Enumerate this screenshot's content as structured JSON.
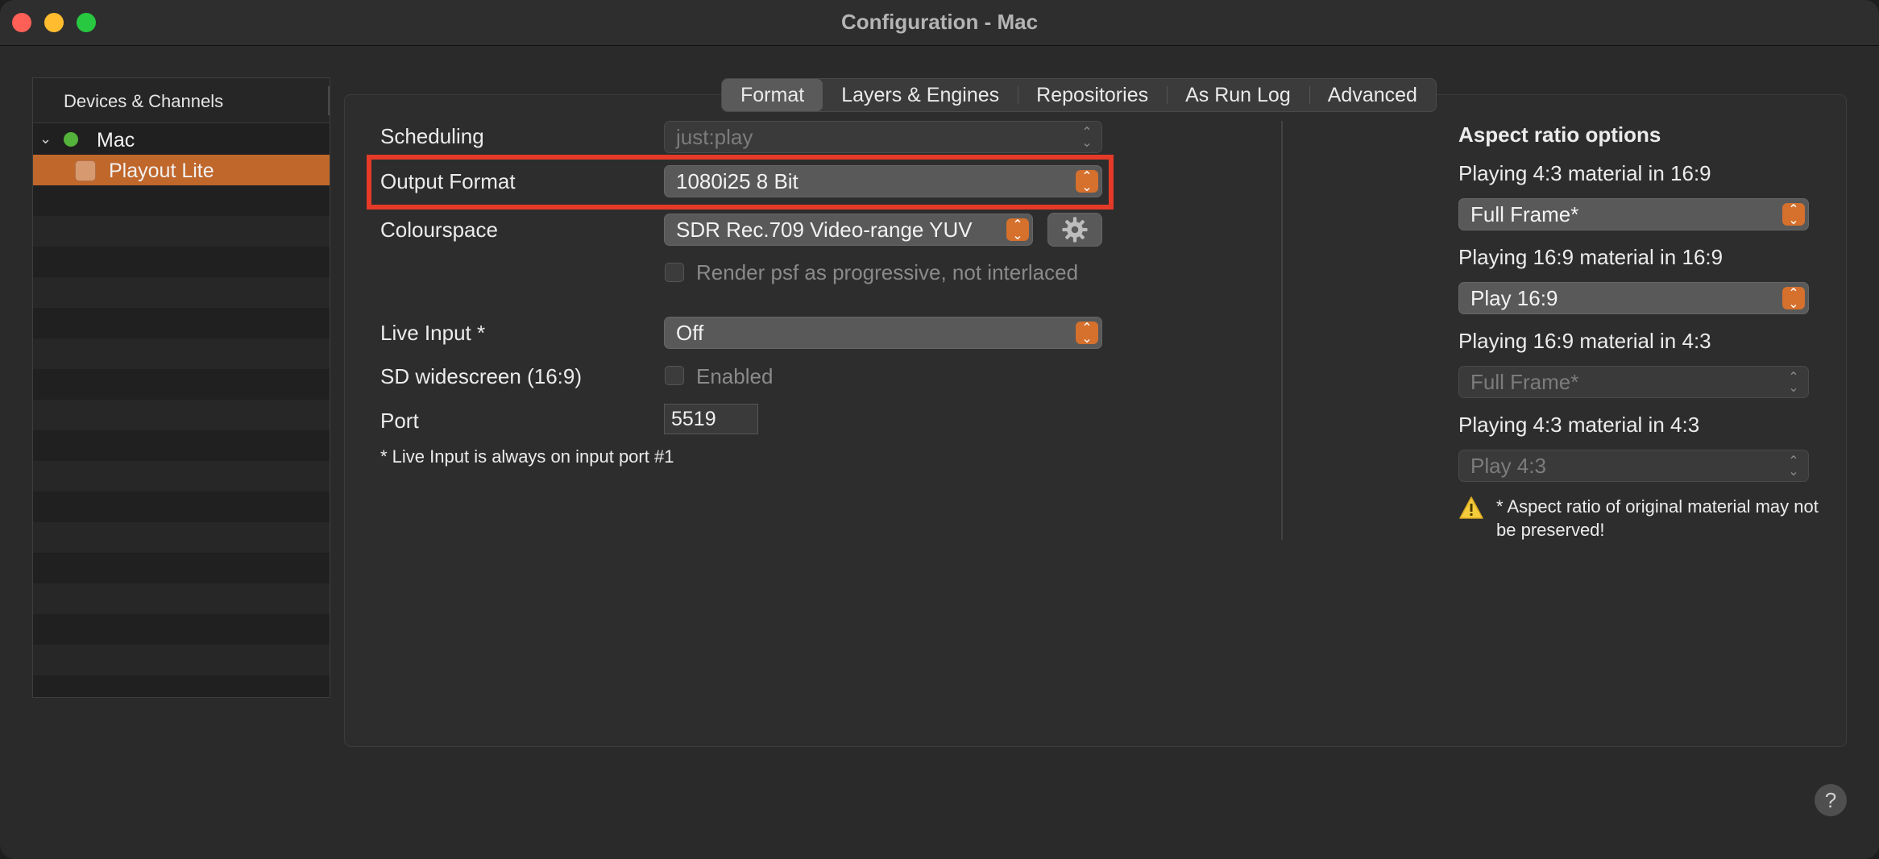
{
  "window": {
    "title": "Configuration - Mac"
  },
  "sidebar": {
    "header": "Devices & Channels",
    "items": [
      {
        "label": "Mac",
        "status_color": "#54b33a"
      },
      {
        "label": "Playout Lite"
      }
    ]
  },
  "tabs": [
    "Format",
    "Layers & Engines",
    "Repositories",
    "As Run Log",
    "Advanced"
  ],
  "format": {
    "scheduling": {
      "label": "Scheduling",
      "value": "just:play"
    },
    "output_format": {
      "label": "Output Format",
      "value": "1080i25 8 Bit"
    },
    "colourspace": {
      "label": "Colourspace",
      "value": "SDR Rec.709 Video-range YUV"
    },
    "render_psf": {
      "label": "Render psf as progressive, not interlaced"
    },
    "live_input": {
      "label": "Live Input *",
      "value": "Off"
    },
    "sd_widescreen": {
      "label": "SD widescreen (16:9)",
      "checkbox_label": "Enabled"
    },
    "port": {
      "label": "Port",
      "value": "5519"
    },
    "footnote": "* Live Input is always on input port #1"
  },
  "aspect": {
    "title": "Aspect ratio options",
    "options": [
      {
        "label": "Playing 4:3 material in 16:9",
        "value": "Full Frame*"
      },
      {
        "label": "Playing 16:9 material in 16:9",
        "value": "Play 16:9"
      },
      {
        "label": "Playing 16:9 material in 4:3",
        "value": "Full Frame*"
      },
      {
        "label": "Playing 4:3 material in 4:3",
        "value": "Play 4:3"
      }
    ],
    "warning": "* Aspect ratio of original material may not be preserved!"
  },
  "help_label": "?",
  "colors": {
    "accent": "#d5702d",
    "highlight": "#e53a27",
    "selected_row": "#c0672b"
  }
}
